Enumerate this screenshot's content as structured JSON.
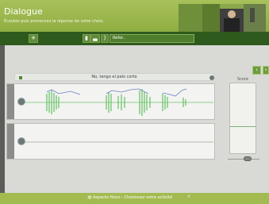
{
  "header": {
    "title": "Dialogue",
    "subtitle": "Écoutez puis prononcez la réponse de votre choix."
  },
  "toolbar": {
    "phrase_preview": "Refor..",
    "left_icon": "tools-icon",
    "right_prev": "‹",
    "right_next": "›"
  },
  "exercise": {
    "phrase": "No, tengo el pelo corto"
  },
  "score": {
    "label": "Score"
  },
  "footer": {
    "text": "Aspecto físico : Choisissez votre activité"
  }
}
